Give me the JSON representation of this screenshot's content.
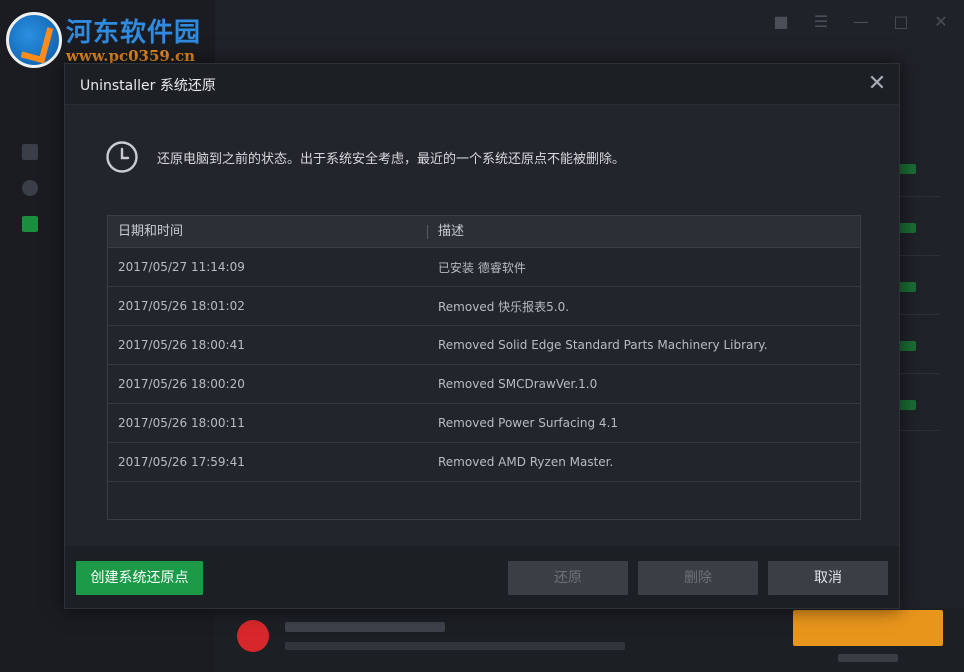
{
  "watermark": {
    "site_name": "河东软件园",
    "site_url": "www.pc0359.cn"
  },
  "dialog": {
    "title": "Uninstaller 系统还原",
    "close_icon": "close-icon",
    "info_icon": "clock-icon",
    "info_text": "还原电脑到之前的状态。出于系统安全考虑，最近的一个系统还原点不能被删除。",
    "table": {
      "headers": [
        "日期和时间",
        "描述"
      ],
      "rows": [
        {
          "date": "2017/05/27 11:14:09",
          "desc": "已安装 德睿软件"
        },
        {
          "date": "2017/05/26 18:01:02",
          "desc": "Removed 快乐报表5.0."
        },
        {
          "date": "2017/05/26 18:00:41",
          "desc": "Removed Solid Edge Standard Parts Machinery Library."
        },
        {
          "date": "2017/05/26 18:00:20",
          "desc": "Removed SMCDrawVer.1.0"
        },
        {
          "date": "2017/05/26 18:00:11",
          "desc": "Removed Power Surfacing 4.1"
        },
        {
          "date": "2017/05/26 17:59:41",
          "desc": "Removed AMD Ryzen Master."
        }
      ]
    },
    "buttons": {
      "create": "创建系统还原点",
      "restore": "还原",
      "delete": "删除",
      "cancel": "取消"
    }
  },
  "colors": {
    "accent_green": "#1c9a47",
    "accent_orange": "#e8951c",
    "dialog_bg": "#22252b"
  }
}
